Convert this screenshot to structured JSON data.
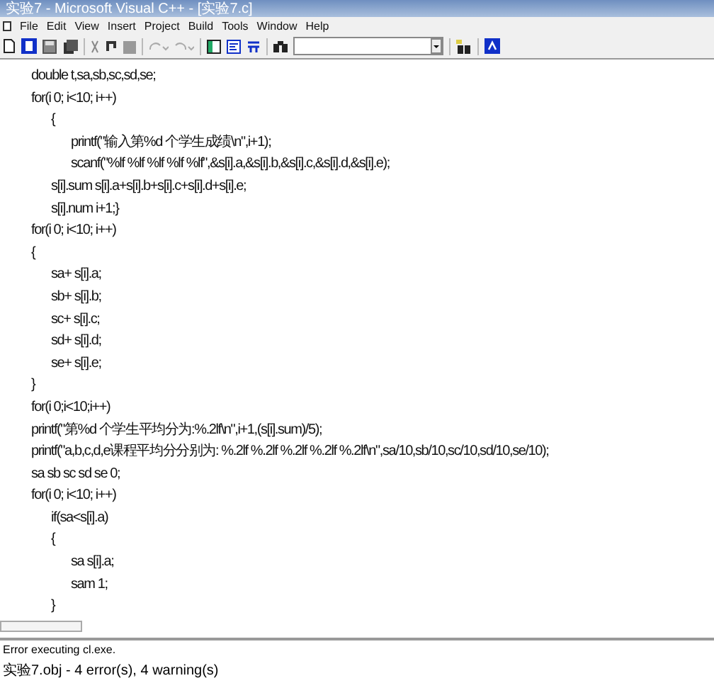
{
  "window": {
    "title": "实验7 - Microsoft Visual C++ - [实验7.c]"
  },
  "menu": [
    "File",
    "Edit",
    "View",
    "Insert",
    "Project",
    "Build",
    "Tools",
    "Window",
    "Help"
  ],
  "code_lines": [
    "\tdouble t,sa,sb,sc,sd,se;",
    "\tfor(i 0; i<10; i++)",
    "\t\t{",
    "\t\t\tprintf(\"输入第%d 个学生成绩\\n\",i+1);",
    "\t\t\tscanf(\"%lf %lf %lf %lf %lf\",&s[i].a,&s[i].b,&s[i].c,&s[i].d,&s[i].e);",
    "\t\ts[i].sum s[i].a+s[i].b+s[i].c+s[i].d+s[i].e;",
    "\t\ts[i].num i+1;}",
    "\tfor(i 0; i<10; i++)",
    "\t{",
    "\t\tsa+ s[i].a;",
    "\t\tsb+ s[i].b;",
    "\t\tsc+ s[i].c;",
    "\t\tsd+ s[i].d;",
    "\t\tse+ s[i].e;",
    "\t}",
    "\tfor(i 0;i<10;i++)",
    "\tprintf(\"第%d 个学生平均分为:%.2lf\\n\",i+1,(s[i].sum)/5);",
    "\tprintf(\"a,b,c,d,e课程平均分分别为: %.2lf %.2lf %.2lf %.2lf %.2lf\\n\",sa/10,sb/10,sc/10,sd/10,se/10);",
    "\tsa sb sc sd se 0;",
    "\tfor(i 0; i<10; i++)",
    "\t\tif(sa<s[i].a)",
    "\t\t{",
    "\t\t\tsa s[i].a;",
    "\t\t\tsam 1;",
    "\t\t}"
  ],
  "output": [
    "Error executing cl.exe.",
    "实验7.obj - 4 error(s), 4 warning(s)"
  ]
}
